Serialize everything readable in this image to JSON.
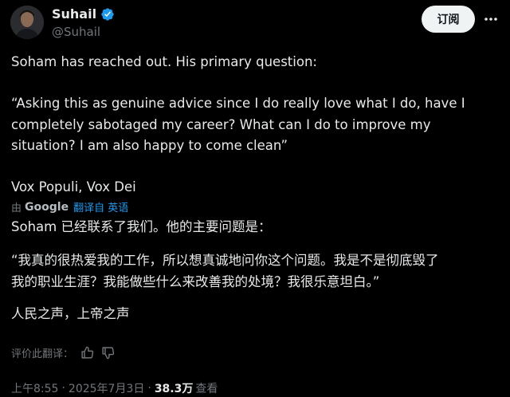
{
  "author": {
    "name": "Suhail",
    "handle": "@Suhail"
  },
  "subscribe_label": "订阅",
  "tweet": {
    "line1": "Soham has reached out. His primary question:",
    "quote_lines": [
      "“Asking this as genuine advice since I do really love what I do, have I",
      "completely sabotaged my career? What can I do to improve my",
      "situation? I am also happy to come clean”"
    ],
    "sign_off": "Vox Populi, Vox Dei"
  },
  "translation": {
    "prefix": "由",
    "provider": "Google",
    "link": "翻译自 英语",
    "line1": "Soham 已经联系了我们。他的主要问题是：",
    "quote_lines": [
      "“我真的很热爱我的工作，所以想真诚地问你这个问题。我是不是彻底毁了",
      "我的职业生涯？我能做些什么来改善我的处境？我很乐意坦白。”"
    ],
    "sign_off": "人民之声，上帝之声"
  },
  "rate_label": "评价此翻译：",
  "meta": {
    "time": "上午8:55",
    "sep1": "·",
    "date": "2025年7月3日",
    "sep2": "·",
    "views_count": "38.3万",
    "views_label": "查看"
  },
  "colors": {
    "background": "#000000",
    "text": "#e7e9ea",
    "muted": "#71767b",
    "accent": "#1d9bf0",
    "button_bg": "#eff3f4"
  },
  "icons": [
    "verified-badge-icon",
    "more-icon",
    "thumbs-up-icon",
    "thumbs-down-icon"
  ]
}
